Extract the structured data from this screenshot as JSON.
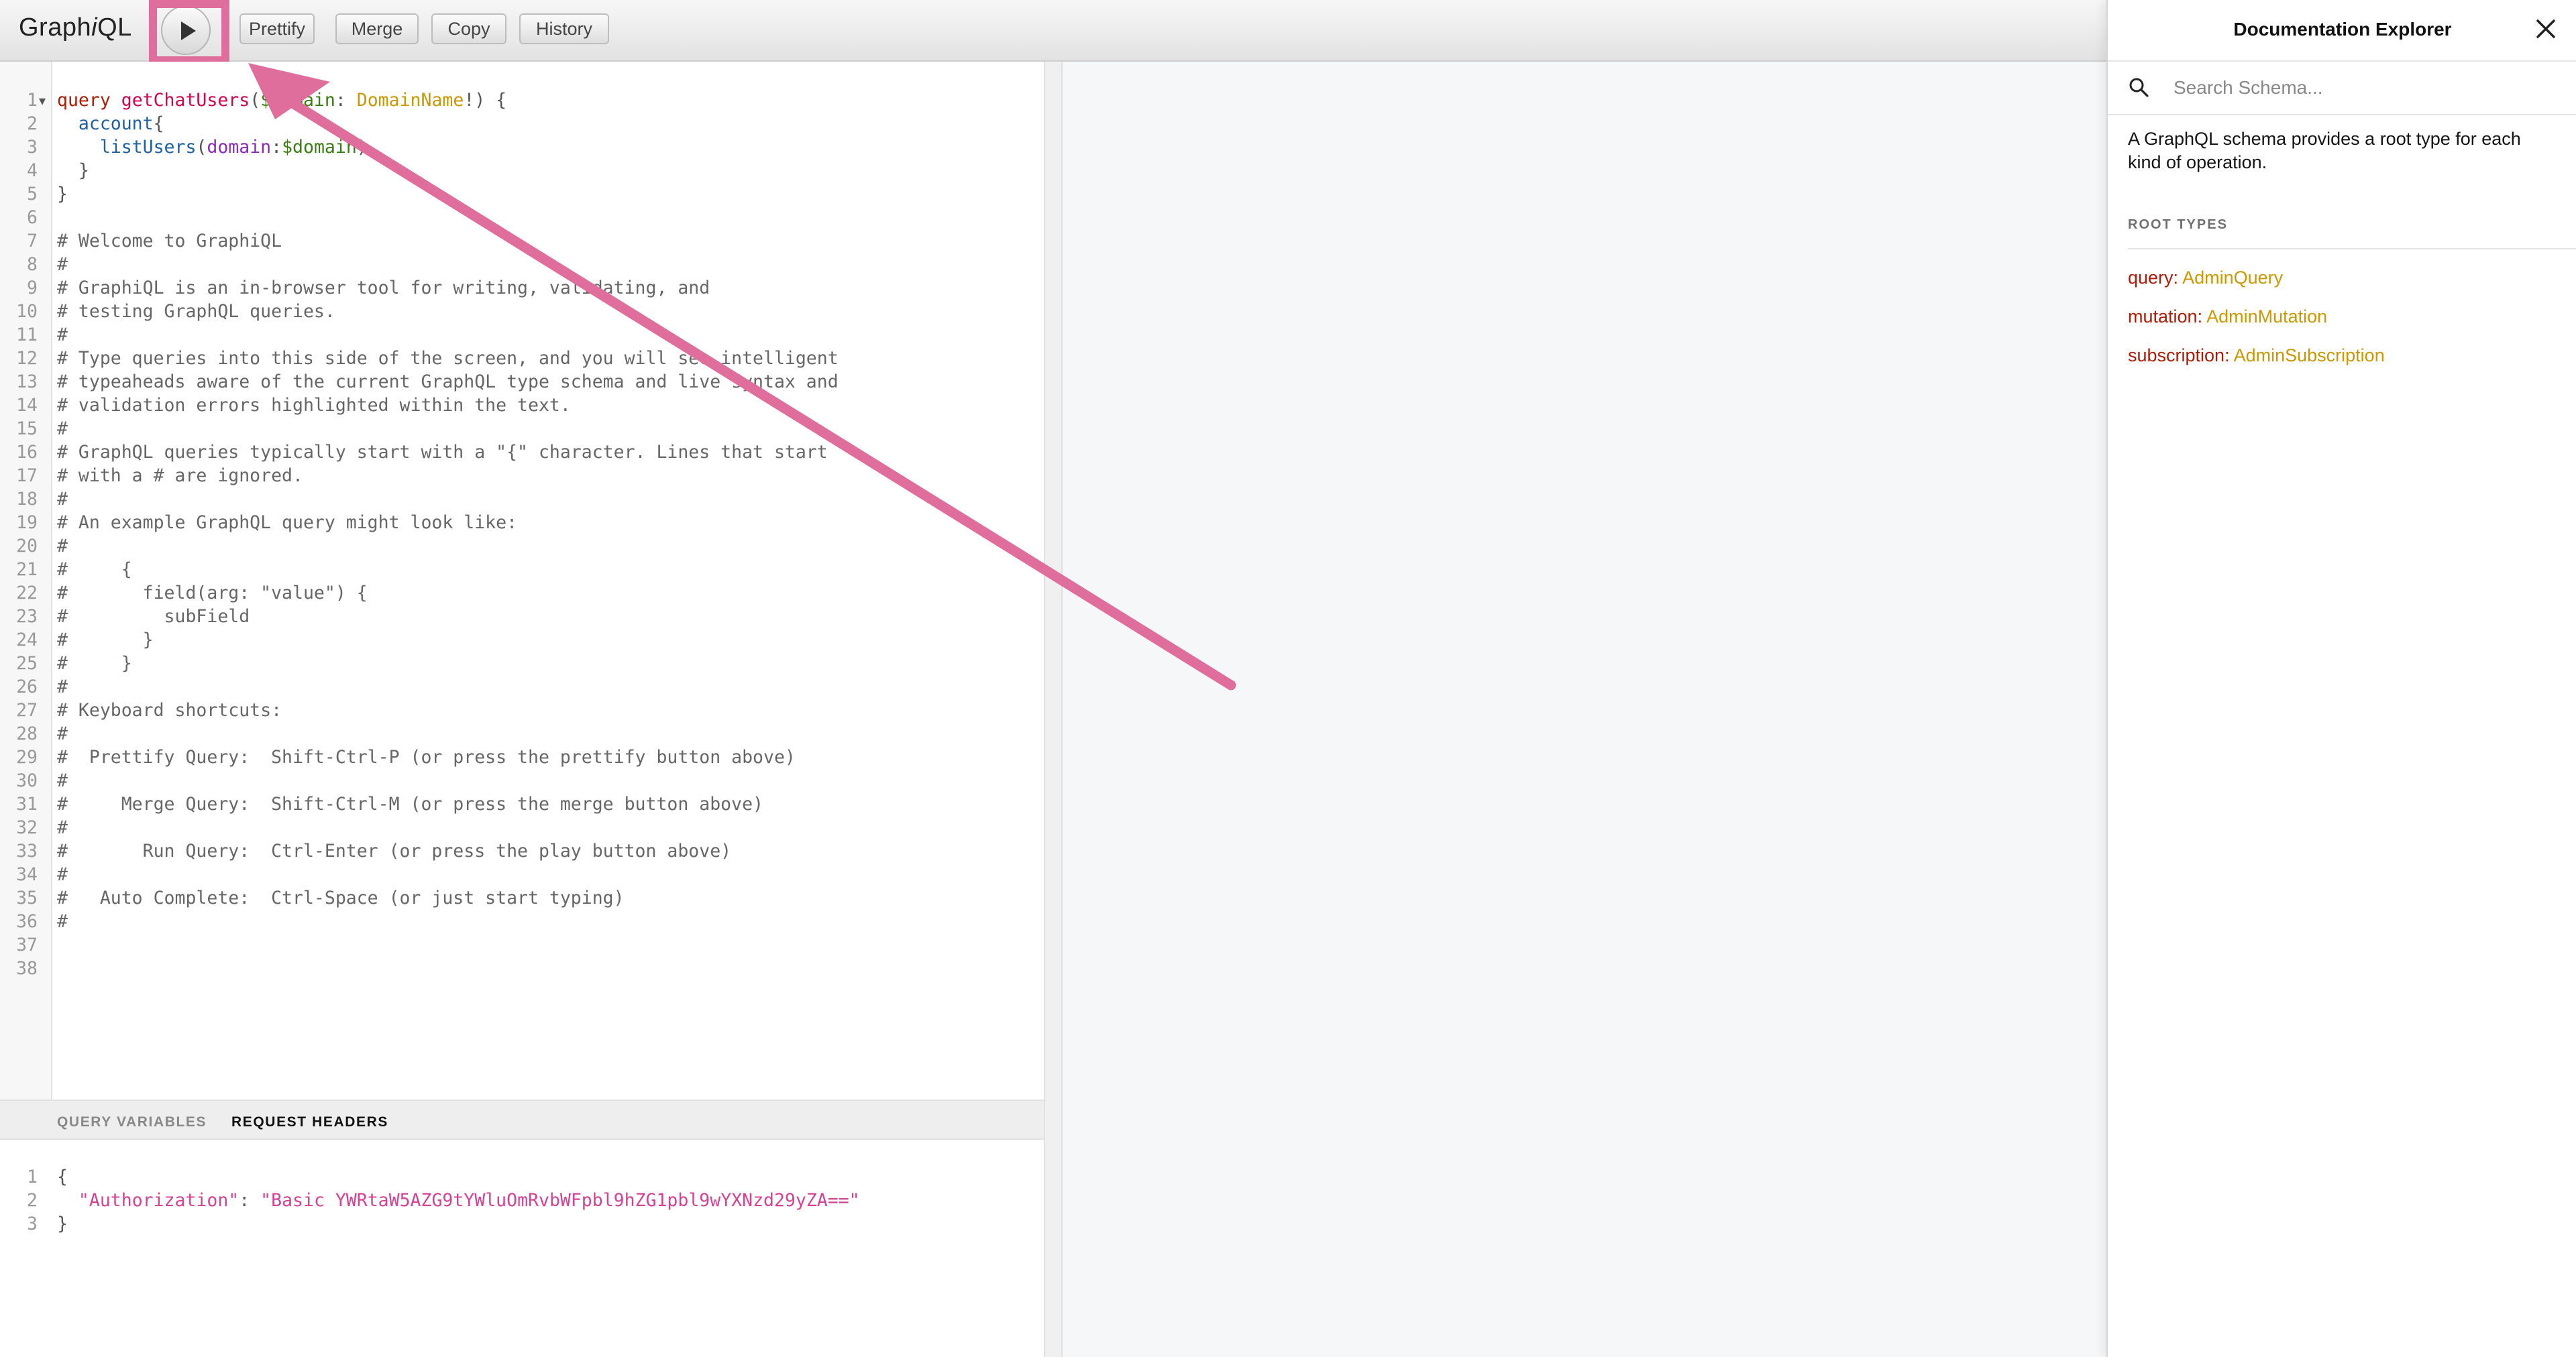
{
  "toolbar": {
    "title_prefix": "Graph",
    "title_italic": "i",
    "title_suffix": "QL",
    "buttons": [
      {
        "label": "Prettify"
      },
      {
        "label": "Merge"
      },
      {
        "label": "Copy"
      },
      {
        "label": "History"
      }
    ]
  },
  "editor": {
    "line_numbers": [
      "1",
      "2",
      "3",
      "4",
      "5",
      "6",
      "7",
      "8",
      "9",
      "10",
      "11",
      "12",
      "13",
      "14",
      "15",
      "16",
      "17",
      "18",
      "19",
      "20",
      "21",
      "22",
      "23",
      "24",
      "25",
      "26",
      "27",
      "28",
      "29",
      "30",
      "31",
      "32",
      "33",
      "34",
      "35",
      "36",
      "37",
      "38"
    ],
    "lines": [
      [
        [
          "kw",
          "query "
        ],
        [
          "def",
          "getChatUsers"
        ],
        [
          "punct",
          "("
        ],
        [
          "var",
          "$domain"
        ],
        [
          "punct",
          ": "
        ],
        [
          "type",
          "DomainName"
        ],
        [
          "punct",
          "!) {"
        ]
      ],
      [
        [
          "prop",
          "  account"
        ],
        [
          "punct",
          "{"
        ]
      ],
      [
        [
          "prop",
          "    listUsers"
        ],
        [
          "punct",
          "("
        ],
        [
          "attr",
          "domain"
        ],
        [
          "punct",
          ":"
        ],
        [
          "var",
          "$domain"
        ],
        [
          "punct",
          ")"
        ]
      ],
      [
        [
          "punct",
          "  }"
        ]
      ],
      [
        [
          "punct",
          "}"
        ]
      ],
      [],
      [
        [
          "comment",
          "# Welcome to GraphiQL"
        ]
      ],
      [
        [
          "comment",
          "#"
        ]
      ],
      [
        [
          "comment",
          "# GraphiQL is an in-browser tool for writing, validating, and"
        ]
      ],
      [
        [
          "comment",
          "# testing GraphQL queries."
        ]
      ],
      [
        [
          "comment",
          "#"
        ]
      ],
      [
        [
          "comment",
          "# Type queries into this side of the screen, and you will see intelligent"
        ]
      ],
      [
        [
          "comment",
          "# typeaheads aware of the current GraphQL type schema and live syntax and"
        ]
      ],
      [
        [
          "comment",
          "# validation errors highlighted within the text."
        ]
      ],
      [
        [
          "comment",
          "#"
        ]
      ],
      [
        [
          "comment",
          "# GraphQL queries typically start with a \"{\" character. Lines that start"
        ]
      ],
      [
        [
          "comment",
          "# with a # are ignored."
        ]
      ],
      [
        [
          "comment",
          "#"
        ]
      ],
      [
        [
          "comment",
          "# An example GraphQL query might look like:"
        ]
      ],
      [
        [
          "comment",
          "#"
        ]
      ],
      [
        [
          "comment",
          "#     {"
        ]
      ],
      [
        [
          "comment",
          "#       field(arg: \"value\") {"
        ]
      ],
      [
        [
          "comment",
          "#         subField"
        ]
      ],
      [
        [
          "comment",
          "#       }"
        ]
      ],
      [
        [
          "comment",
          "#     }"
        ]
      ],
      [
        [
          "comment",
          "#"
        ]
      ],
      [
        [
          "comment",
          "# Keyboard shortcuts:"
        ]
      ],
      [
        [
          "comment",
          "#"
        ]
      ],
      [
        [
          "comment",
          "#  Prettify Query:  Shift-Ctrl-P (or press the prettify button above)"
        ]
      ],
      [
        [
          "comment",
          "#"
        ]
      ],
      [
        [
          "comment",
          "#     Merge Query:  Shift-Ctrl-M (or press the merge button above)"
        ]
      ],
      [
        [
          "comment",
          "#"
        ]
      ],
      [
        [
          "comment",
          "#       Run Query:  Ctrl-Enter (or press the play button above)"
        ]
      ],
      [
        [
          "comment",
          "#"
        ]
      ],
      [
        [
          "comment",
          "#   Auto Complete:  Ctrl-Space (or just start typing)"
        ]
      ],
      [
        [
          "comment",
          "#"
        ]
      ],
      [],
      []
    ]
  },
  "variables_pane": {
    "tabs": [
      "QUERY VARIABLES",
      "REQUEST HEADERS"
    ],
    "line_numbers": [
      "1",
      "2",
      "3"
    ],
    "lines": [
      [
        [
          "punct",
          "{"
        ]
      ],
      [
        [
          "punct",
          "  "
        ],
        [
          "str",
          "\"Authorization\""
        ],
        [
          "punct",
          ": "
        ],
        [
          "str",
          "\"Basic YWRtaW5AZG9tYWluOmRvbWFpbl9hZG1pbl9wYXNzd29yZA==\""
        ]
      ],
      [
        [
          "punct",
          "}"
        ]
      ]
    ]
  },
  "doc_explorer": {
    "title": "Documentation Explorer",
    "search_placeholder": "Search Schema...",
    "description": "A GraphQL schema provides a root type for each kind of operation.",
    "root_types_label": "ROOT TYPES",
    "root_types": [
      {
        "field": "query",
        "type": "AdminQuery"
      },
      {
        "field": "mutation",
        "type": "AdminMutation"
      },
      {
        "field": "subscription",
        "type": "AdminSubscription"
      }
    ]
  },
  "colors": {
    "annotation": "#e06e9c",
    "keyword": "#b11a04",
    "type_name": "#ca9800",
    "string": "#d64292"
  },
  "icons": [
    "play-icon",
    "search-icon",
    "close-icon"
  ]
}
